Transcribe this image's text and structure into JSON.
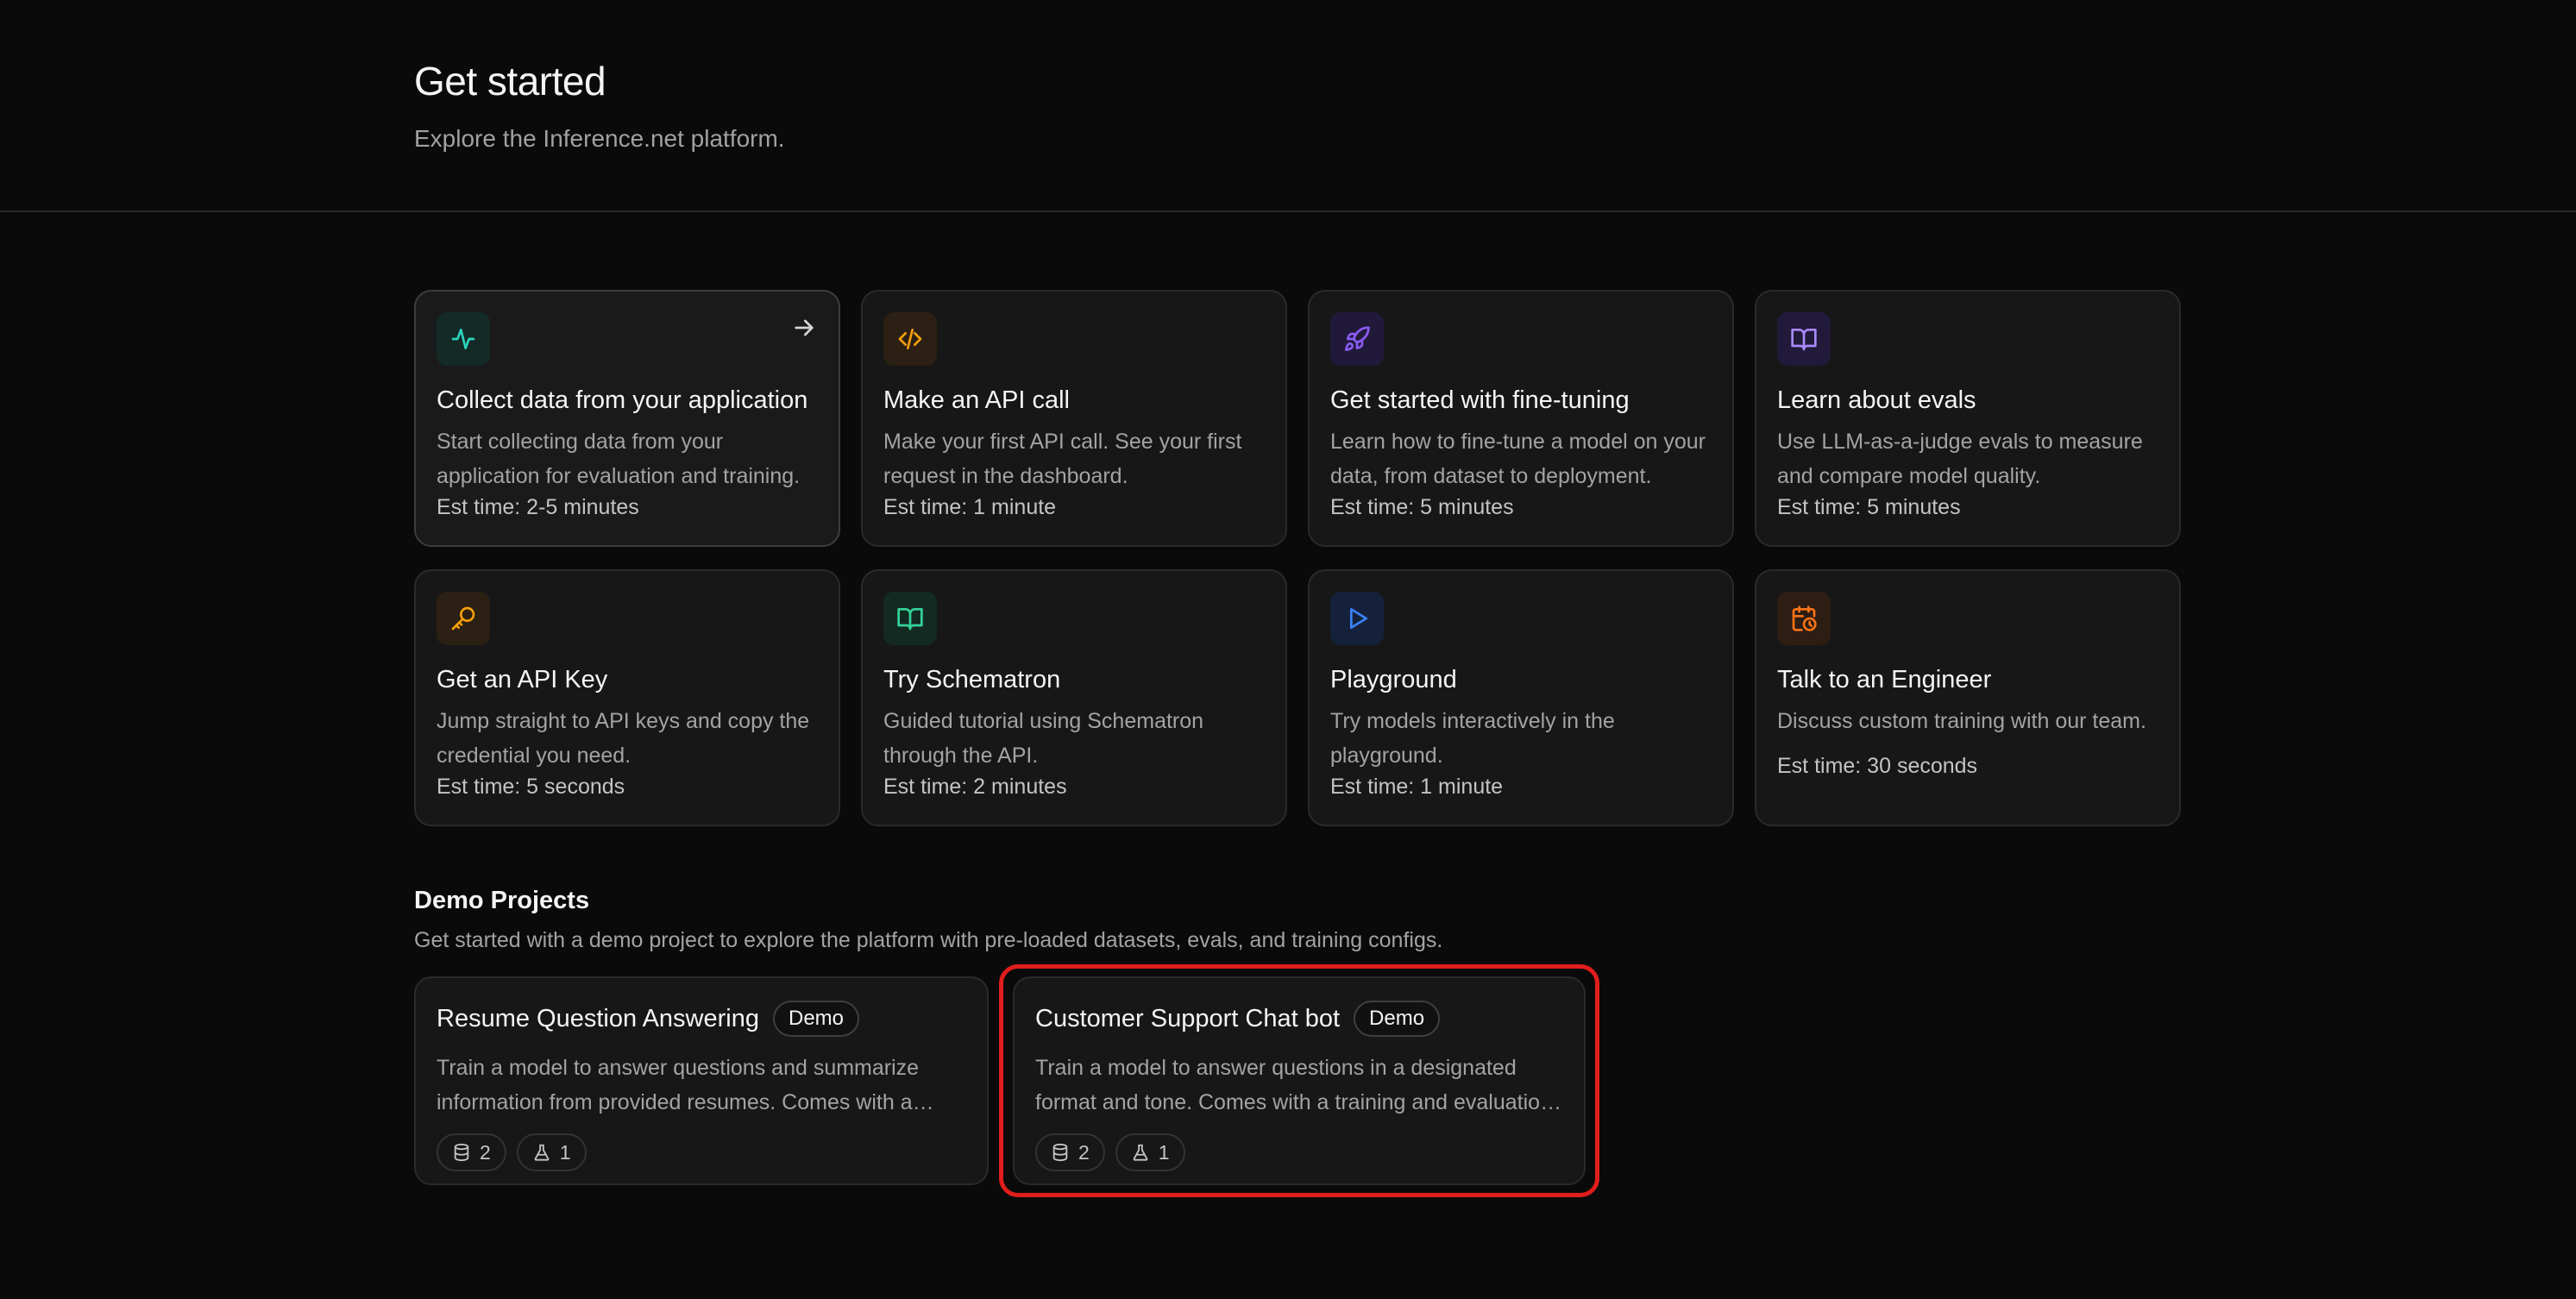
{
  "header": {
    "title": "Get started",
    "subtitle": "Explore the Inference.net platform."
  },
  "cards": [
    {
      "icon": "activity-icon",
      "color": "#2dd4bf",
      "bg": "#132a27",
      "title": "Collect data from your application",
      "desc": "Start collecting data from your application for evaluation and training.",
      "time": "Est time: 2-5 minutes"
    },
    {
      "icon": "code-icon",
      "color": "#f59e0b",
      "bg": "#2b2013",
      "title": "Make an API call",
      "desc": "Make your first API call. See your first request in the dashboard.",
      "time": "Est time: 1 minute"
    },
    {
      "icon": "rocket-icon",
      "color": "#8b5cf6",
      "bg": "#21193a",
      "title": "Get started with fine-tuning",
      "desc": "Learn how to fine-tune a model on your data, from dataset to deployment.",
      "time": "Est time: 5 minutes"
    },
    {
      "icon": "book-open-icon",
      "color": "#a78bfa",
      "bg": "#221a3a",
      "title": "Learn about evals",
      "desc": "Use LLM-as-a-judge evals to measure and compare model quality.",
      "time": "Est time: 5 minutes"
    },
    {
      "icon": "key-icon",
      "color": "#f59e0b",
      "bg": "#2b2013",
      "title": "Get an API Key",
      "desc": "Jump straight to API keys and copy the credential you need.",
      "time": "Est time: 5 seconds"
    },
    {
      "icon": "book-open-icon",
      "color": "#34d399",
      "bg": "#132a22",
      "title": "Try Schematron",
      "desc": "Guided tutorial using Schematron through the API.",
      "time": "Est time: 2 minutes"
    },
    {
      "icon": "play-icon",
      "color": "#3b82f6",
      "bg": "#15213a",
      "title": "Playground",
      "desc": "Try models interactively in the playground.",
      "time": "Est time: 1 minute"
    },
    {
      "icon": "calendar-clock-icon",
      "color": "#f97316",
      "bg": "#2d1d12",
      "title": "Talk to an Engineer",
      "desc": "Discuss custom training with our team.",
      "time": "Est time: 30 seconds"
    }
  ],
  "demo": {
    "title": "Demo Projects",
    "subtitle": "Get started with a demo project to explore the platform with pre-loaded datasets, evals, and training configs.",
    "projects": [
      {
        "name": "Resume Question Answering",
        "badge": "Demo",
        "desc": "Train a model to answer questions and summarize information from provided resumes. Comes with a training and evaluation dataset.",
        "datasets": "2",
        "evals": "1"
      },
      {
        "name": "Customer Support Chat bot",
        "badge": "Demo",
        "desc": "Train a model to answer questions in a designated format and tone. Comes with a training and evaluation dataset.",
        "datasets": "2",
        "evals": "1"
      }
    ]
  },
  "highlight_color": "#e11d1d"
}
